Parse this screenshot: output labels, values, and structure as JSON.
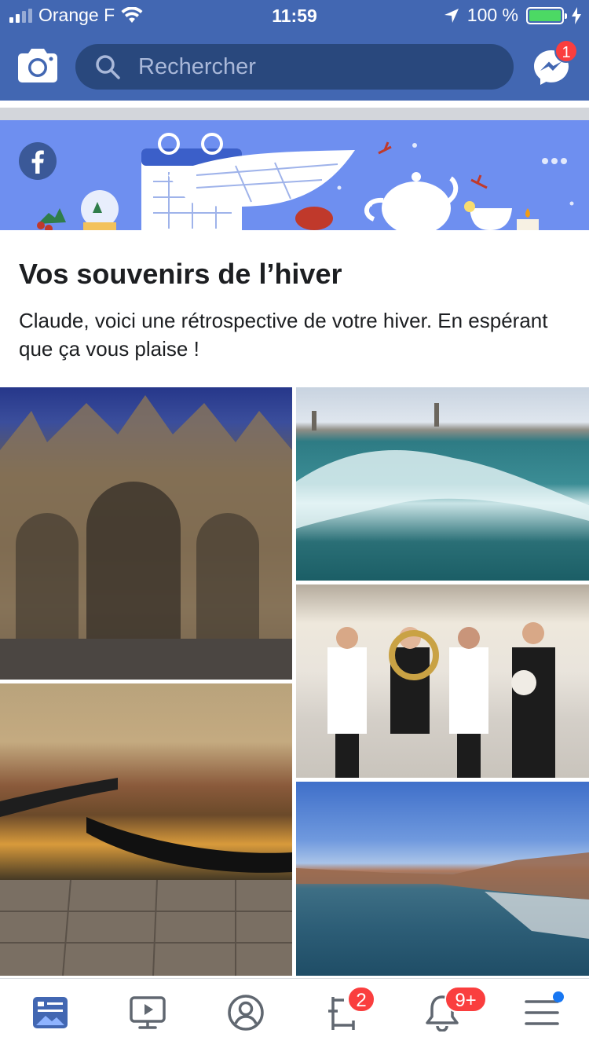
{
  "status_bar": {
    "carrier": "Orange F",
    "time": "11:59",
    "battery": "100 %"
  },
  "header": {
    "search_placeholder": "Rechercher",
    "messenger_badge": "1"
  },
  "memory_card": {
    "title": "Vos souvenirs de l’hiver",
    "description": "Claude, voici une rétrospective de votre hiver. En espérant que ça vous plaise !"
  },
  "tabbar": {
    "friend_requests_badge": "2",
    "notifications_badge": "9+"
  },
  "colors": {
    "brand_blue": "#4267b2",
    "search_bg": "#29487d",
    "banner_blue": "#6e8ff0",
    "badge_red": "#fa3e3e"
  }
}
